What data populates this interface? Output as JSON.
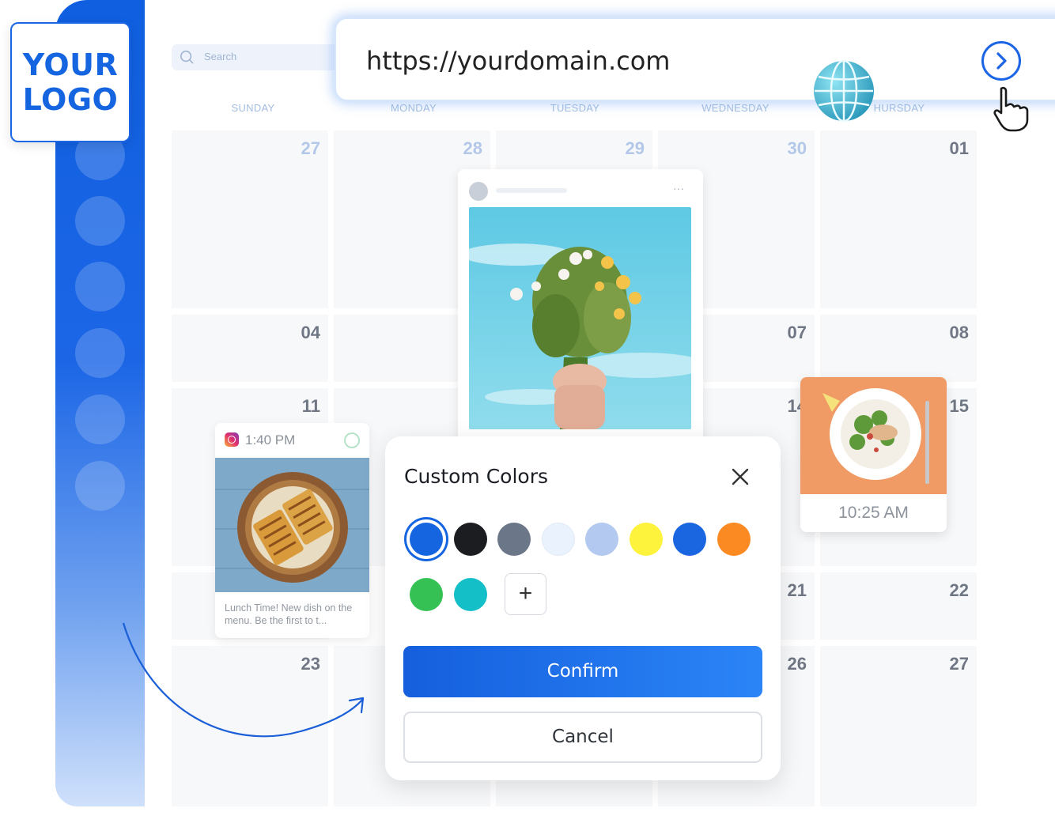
{
  "logo": {
    "line1": "YOUR",
    "line2": "LOGO"
  },
  "browser": {
    "url": "https://yourdomain.com",
    "go_icon": "chevron-right-icon",
    "globe_icon": "globe-icon",
    "cursor_icon": "pointer-hand-icon"
  },
  "search": {
    "placeholder": "Search",
    "icon": "search-icon"
  },
  "calendar": {
    "day_names": [
      "SUNDAY",
      "MONDAY",
      "TUESDAY",
      "WEDNESDAY",
      "HURSDAY"
    ],
    "dates": {
      "r1": [
        "27",
        "28",
        "29",
        "30",
        "01"
      ],
      "r2_sun": "04",
      "r2_wed": "07",
      "r2_thu": "08",
      "r3_sun": "11",
      "r3_wed": "14",
      "r3_thu": "15",
      "r4_wed": "21",
      "r4_thu": "22",
      "r5_sun": "23",
      "r5_wed": "26",
      "r5_thu": "27"
    }
  },
  "posts": {
    "flowers": {
      "more": "···"
    },
    "instagram": {
      "time": "1:40 PM",
      "caption": "Lunch Time! New dish on the menu. Be the first to t..."
    },
    "salad": {
      "time": "10:25 AM"
    }
  },
  "modal": {
    "title": "Custom Colors",
    "swatches": [
      "#1565e0",
      "#1c1d21",
      "#6b7689",
      "#eaf2fd",
      "#b3c9f0",
      "#fdf23c",
      "#1a66e0",
      "#fb8a22",
      "#35c153",
      "#14bfc8"
    ],
    "selected_swatch": "#1565e0",
    "add_label": "+",
    "confirm_label": "Confirm",
    "cancel_label": "Cancel"
  }
}
